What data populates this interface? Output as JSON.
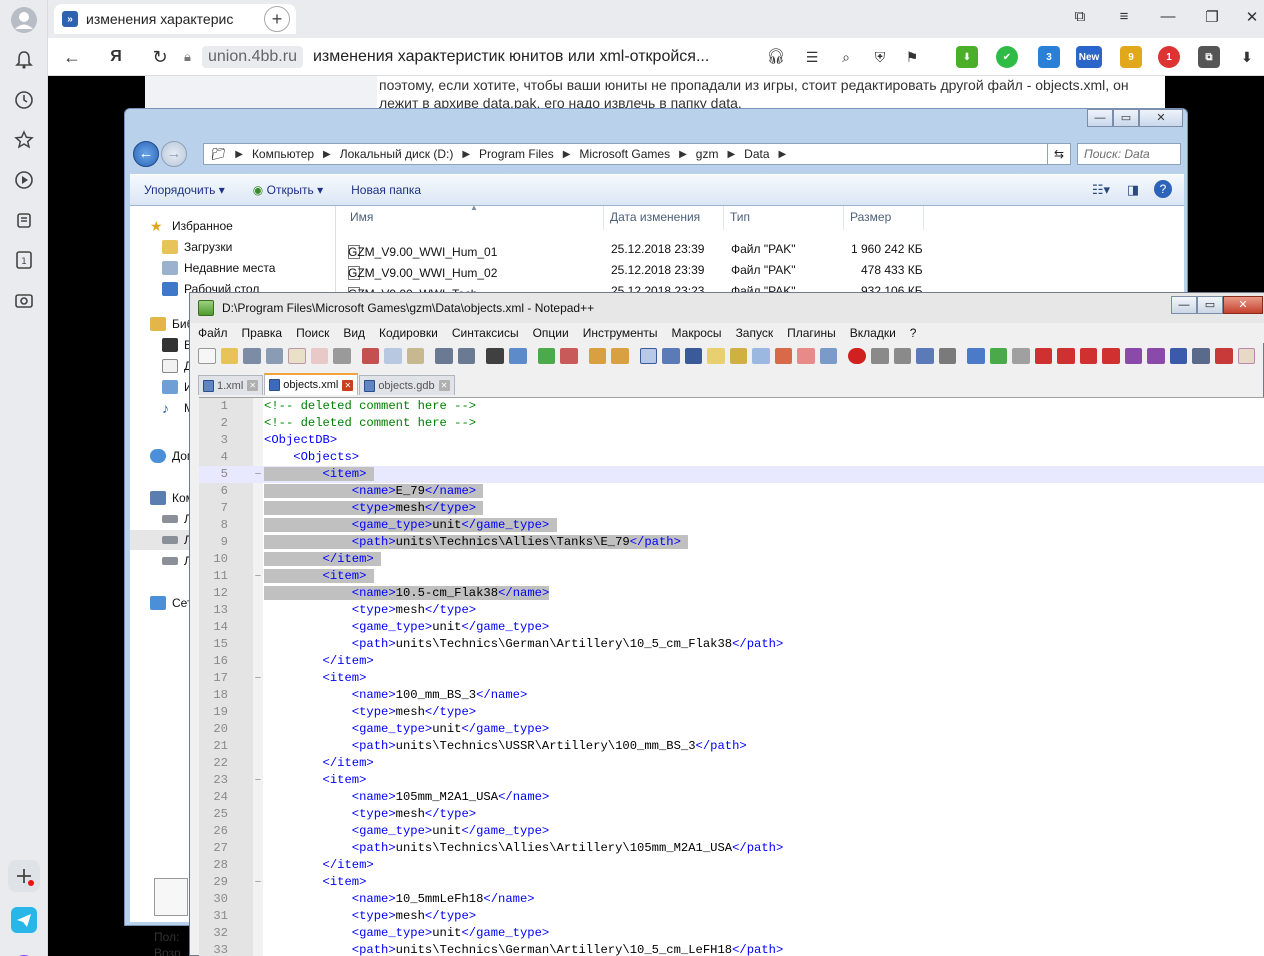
{
  "browser": {
    "tab_title": "изменения характерис",
    "url_domain": "union.4bb.ru",
    "page_title": "изменения характеристик юнитов или xml-откройся...",
    "ext_badges": [
      "3",
      "New",
      "9",
      "1"
    ]
  },
  "webpage": {
    "line1": "поэтому, если хотите, чтобы ваши юниты не пропадали из игры, стоит редактировать другой файл - objects.xml, он",
    "line2": "лежит в архиве data.pak, его надо извлечь в папку data."
  },
  "explorer": {
    "breadcrumb": [
      "Компьютер",
      "Локальный диск (D:)",
      "Program Files",
      "Microsoft Games",
      "gzm",
      "Data"
    ],
    "search_placeholder": "Поиск: Data",
    "toolbar": {
      "organize": "Упорядочить",
      "open": "Открыть",
      "new_folder": "Новая папка"
    },
    "tree": [
      {
        "label": "Избранное",
        "icon": "star-icon"
      },
      {
        "label": "Загрузки",
        "icon": "downloads-folder-icon"
      },
      {
        "label": "Недавние места",
        "icon": "recent-places-icon"
      },
      {
        "label": "Рабочий стол",
        "icon": "desktop-icon"
      },
      {
        "label": "Биб",
        "icon": "libraries-icon"
      },
      {
        "label": "Ви",
        "icon": "video-library-icon"
      },
      {
        "label": "Д",
        "icon": "documents-library-icon"
      },
      {
        "label": "И",
        "icon": "images-library-icon"
      },
      {
        "label": "М",
        "icon": "music-library-icon"
      },
      {
        "label": "Дом",
        "icon": "homegroup-icon"
      },
      {
        "label": "Ком",
        "icon": "computer-icon"
      },
      {
        "label": "Л",
        "icon": "drive-icon"
      },
      {
        "label": "Л",
        "icon": "drive-icon"
      },
      {
        "label": "Л",
        "icon": "drive-icon"
      },
      {
        "label": "Сет",
        "icon": "network-icon"
      }
    ],
    "columns": {
      "name": "Имя",
      "date": "Дата изменения",
      "type": "Тип",
      "size": "Размер"
    },
    "files": [
      {
        "name": "GZM_V9.00_WWI_Hum_01",
        "date": "25.12.2018 23:39",
        "type": "Файл \"PAK\"",
        "size": "1 960 242 КБ"
      },
      {
        "name": "GZM_V9.00_WWI_Hum_02",
        "date": "25.12.2018 23:39",
        "type": "Файл \"PAK\"",
        "size": "478 433 КБ"
      },
      {
        "name": "GZM_V9.00_WWI_Tech",
        "date": "25.12.2018 23:23",
        "type": "Файл \"PAK\"",
        "size": "932 106 КБ"
      }
    ],
    "footer": {
      "line1": "Пол:",
      "line2": "Возр"
    }
  },
  "npp": {
    "title": "D:\\Program Files\\Microsoft Games\\gzm\\Data\\objects.xml - Notepad++",
    "menu": [
      "Файл",
      "Правка",
      "Поиск",
      "Вид",
      "Кодировки",
      "Синтаксисы",
      "Опции",
      "Инструменты",
      "Макросы",
      "Запуск",
      "Плагины",
      "Вкладки",
      "?"
    ],
    "tabs": [
      {
        "label": "1.xml",
        "active": false
      },
      {
        "label": "objects.xml",
        "active": true
      },
      {
        "label": "objects.gdb",
        "active": false
      }
    ],
    "lines": [
      {
        "n": "1",
        "ind": 0,
        "kind": "cmt",
        "text": "<!-- deleted comment here -->"
      },
      {
        "n": "2",
        "ind": 0,
        "kind": "cmt",
        "text": "<!-- deleted comment here -->"
      },
      {
        "n": "3",
        "ind": 0,
        "kind": "tag",
        "text": "<ObjectDB>"
      },
      {
        "n": "4",
        "ind": 1,
        "kind": "tag",
        "text": "<Objects>"
      },
      {
        "n": "5",
        "ind": 2,
        "kind": "tag",
        "text": "<item>"
      },
      {
        "n": "6",
        "ind": 3,
        "kind": "el",
        "tag": "name",
        "val": "E_79"
      },
      {
        "n": "7",
        "ind": 3,
        "kind": "el",
        "tag": "type",
        "val": "mesh"
      },
      {
        "n": "8",
        "ind": 3,
        "kind": "el",
        "tag": "game_type",
        "val": "unit"
      },
      {
        "n": "9",
        "ind": 3,
        "kind": "el",
        "tag": "path",
        "val": "units\\Technics\\Allies\\Tanks\\E_79"
      },
      {
        "n": "10",
        "ind": 2,
        "kind": "tag",
        "text": "</item>"
      },
      {
        "n": "11",
        "ind": 2,
        "kind": "tag",
        "text": "<item>"
      },
      {
        "n": "12",
        "ind": 3,
        "kind": "el",
        "tag": "name",
        "val": "10.5-cm_Flak38"
      },
      {
        "n": "13",
        "ind": 3,
        "kind": "el",
        "tag": "type",
        "val": "mesh"
      },
      {
        "n": "14",
        "ind": 3,
        "kind": "el",
        "tag": "game_type",
        "val": "unit"
      },
      {
        "n": "15",
        "ind": 3,
        "kind": "el",
        "tag": "path",
        "val": "units\\Technics\\German\\Artillery\\10_5_cm_Flak38"
      },
      {
        "n": "16",
        "ind": 2,
        "kind": "tag",
        "text": "</item>"
      },
      {
        "n": "17",
        "ind": 2,
        "kind": "tag",
        "text": "<item>"
      },
      {
        "n": "18",
        "ind": 3,
        "kind": "el",
        "tag": "name",
        "val": "100_mm_BS_3"
      },
      {
        "n": "19",
        "ind": 3,
        "kind": "el",
        "tag": "type",
        "val": "mesh"
      },
      {
        "n": "20",
        "ind": 3,
        "kind": "el",
        "tag": "game_type",
        "val": "unit"
      },
      {
        "n": "21",
        "ind": 3,
        "kind": "el",
        "tag": "path",
        "val": "units\\Technics\\USSR\\Artillery\\100_mm_BS_3"
      },
      {
        "n": "22",
        "ind": 2,
        "kind": "tag",
        "text": "</item>"
      },
      {
        "n": "23",
        "ind": 2,
        "kind": "tag",
        "text": "<item>"
      },
      {
        "n": "24",
        "ind": 3,
        "kind": "el",
        "tag": "name",
        "val": "105mm_M2A1_USA"
      },
      {
        "n": "25",
        "ind": 3,
        "kind": "el",
        "tag": "type",
        "val": "mesh"
      },
      {
        "n": "26",
        "ind": 3,
        "kind": "el",
        "tag": "game_type",
        "val": "unit"
      },
      {
        "n": "27",
        "ind": 3,
        "kind": "el",
        "tag": "path",
        "val": "units\\Technics\\Allies\\Artillery\\105mm_M2A1_USA"
      },
      {
        "n": "28",
        "ind": 2,
        "kind": "tag",
        "text": "</item>"
      },
      {
        "n": "29",
        "ind": 2,
        "kind": "tag",
        "text": "<item>"
      },
      {
        "n": "30",
        "ind": 3,
        "kind": "el",
        "tag": "name",
        "val": "10_5mmLeFh18"
      },
      {
        "n": "31",
        "ind": 3,
        "kind": "el",
        "tag": "type",
        "val": "mesh"
      },
      {
        "n": "32",
        "ind": 3,
        "kind": "el",
        "tag": "game_type",
        "val": "unit"
      },
      {
        "n": "33",
        "ind": 3,
        "kind": "el",
        "tag": "path",
        "val": "units\\Technics\\German\\Artillery\\10_5_cm_LeFH18"
      }
    ]
  }
}
